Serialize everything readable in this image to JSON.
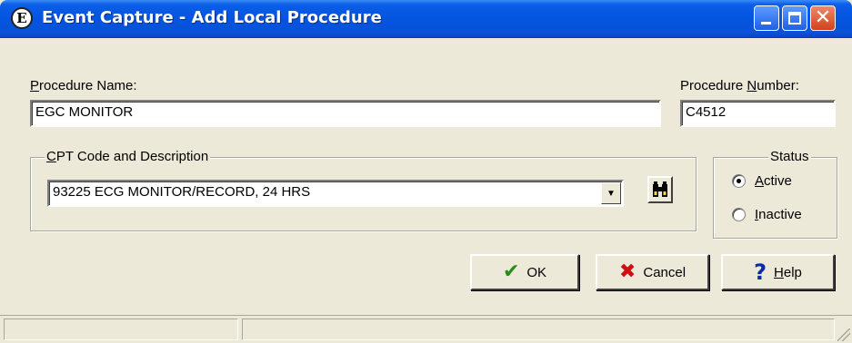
{
  "window": {
    "title": "Event Capture - Add Local Procedure",
    "app_icon": "E"
  },
  "form": {
    "procedure_name": {
      "label_pre": "",
      "label_accel": "P",
      "label_post": "rocedure Name:",
      "value": "EGC MONITOR"
    },
    "procedure_number": {
      "label_pre": "Procedure ",
      "label_accel": "N",
      "label_post": "umber:",
      "value": "C4512"
    },
    "cpt": {
      "legend_accel": "C",
      "legend_post": "PT Code and Description",
      "selected": "93225  ECG MONITOR/RECORD, 24 HRS"
    },
    "status": {
      "legend": "Status",
      "options": [
        {
          "accel": "A",
          "rest": "ctive",
          "checked": true
        },
        {
          "accel": "I",
          "rest": "nactive",
          "checked": false
        }
      ]
    }
  },
  "buttons": {
    "ok": {
      "label": "OK",
      "icon": "checkmark-icon"
    },
    "cancel": {
      "label": "Cancel",
      "icon": "x-icon"
    },
    "help": {
      "label_accel": "H",
      "label_rest": "elp",
      "icon": "question-icon"
    }
  },
  "colors": {
    "titlebar": "#0454e0",
    "ok_icon": "#2a8a1a",
    "cancel_icon": "#d01010",
    "help_icon": "#0a2ca8"
  }
}
